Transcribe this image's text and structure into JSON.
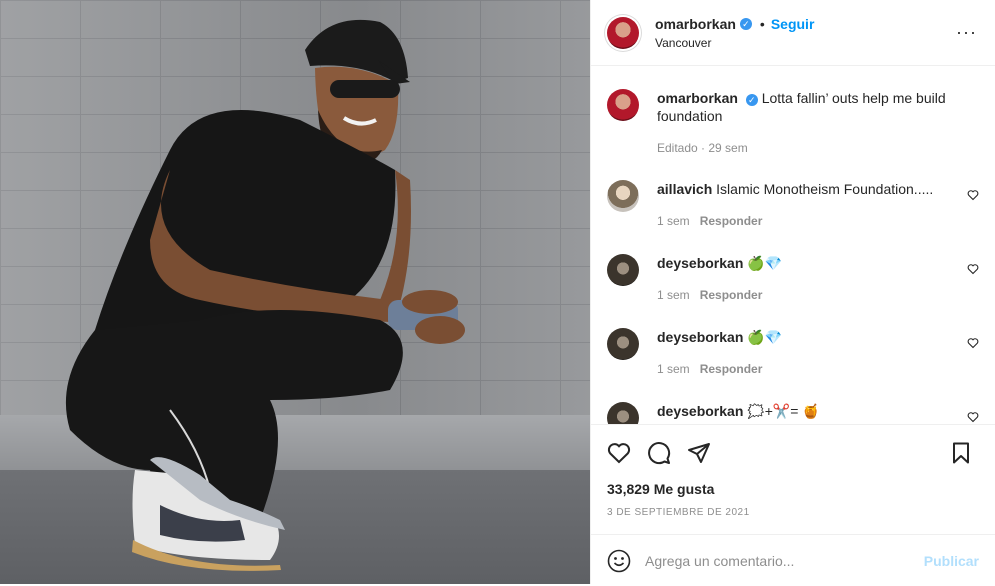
{
  "header": {
    "username": "omarborkan",
    "follow_label": "Seguir",
    "separator": "•",
    "location": "Vancouver",
    "more": "···"
  },
  "caption": {
    "username": "omarborkan",
    "text": "Lotta fallin’ outs help me build foundation",
    "edited": "Editado · 29 sem"
  },
  "comments": [
    {
      "username": "aillavich",
      "text": "Islamic Monotheism Foundation.....",
      "time": "1 sem",
      "reply": "Responder"
    },
    {
      "username": "deyseborkan",
      "text": "🍏💎",
      "time": "1 sem",
      "reply": "Responder"
    },
    {
      "username": "deyseborkan",
      "text": "🍏💎",
      "time": "1 sem",
      "reply": "Responder"
    },
    {
      "username": "deyseborkan",
      "text": "🗯️+✂️= 🍯",
      "time": "",
      "reply": ""
    }
  ],
  "post": {
    "likes": "33,829 Me gusta",
    "date": "3 DE SEPTIEMBRE DE 2021"
  },
  "composer": {
    "placeholder": "Agrega un comentario...",
    "publish": "Publicar"
  },
  "colors": {
    "accent": "#0095f6",
    "publish_disabled": "#b2dffc",
    "muted": "#8e8e8e"
  }
}
